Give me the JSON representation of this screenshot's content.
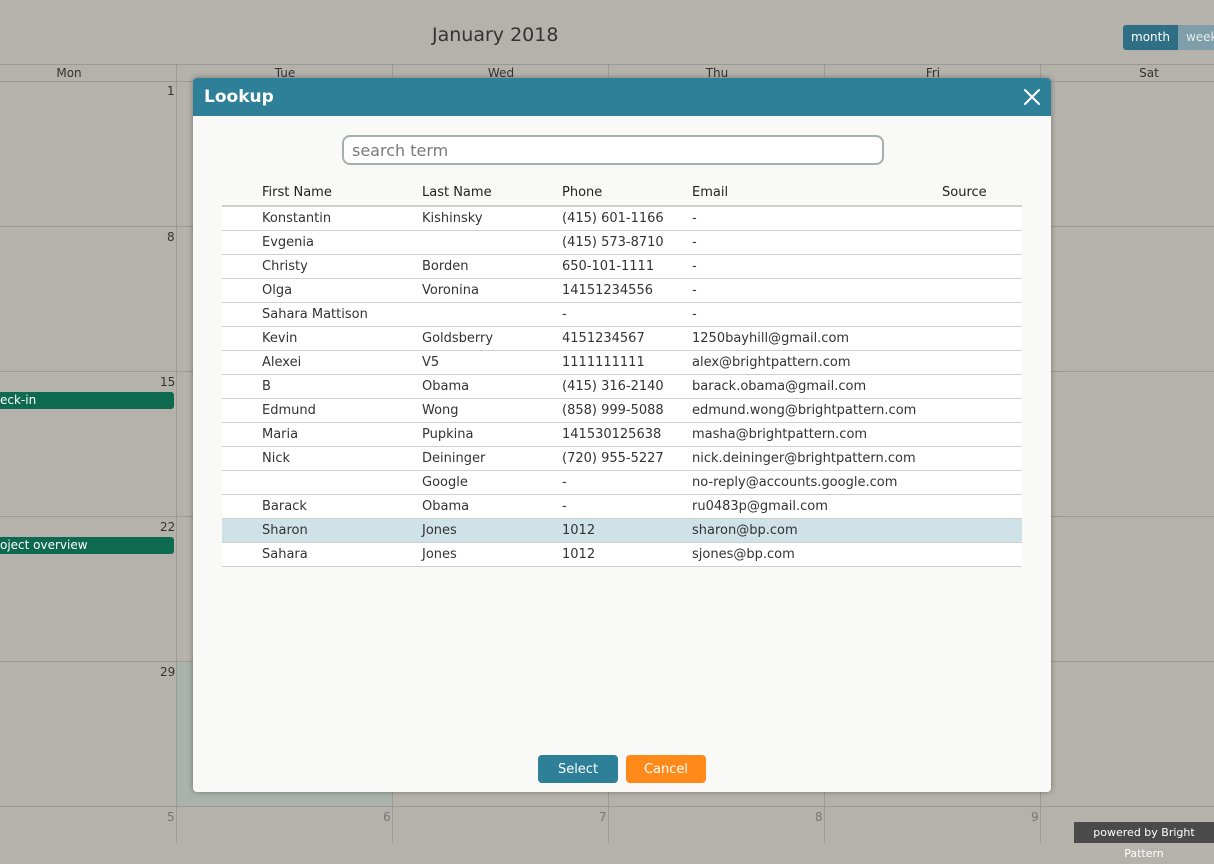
{
  "calendar": {
    "title": "January 2018",
    "views": {
      "month": "month",
      "week": "week"
    },
    "days_of_week": [
      "Mon",
      "Tue",
      "Wed",
      "Thu",
      "Fri",
      "Sat"
    ],
    "day_numbers": [
      "1",
      "8",
      "15",
      "22",
      "29",
      "5",
      "6",
      "7",
      "8",
      "9"
    ],
    "events": [
      "eck-in",
      "oject overview"
    ],
    "colors": {
      "event": "#0d6a4f",
      "view_active": "#2e6f85"
    }
  },
  "lookup": {
    "title": "Lookup",
    "search_placeholder": "search term",
    "columns": [
      "First Name",
      "Last Name",
      "Phone",
      "Email",
      "Source"
    ],
    "rows": [
      {
        "first": "Konstantin",
        "last": "Kishinsky",
        "phone": "(415) 601-1166",
        "email": "-",
        "source": ""
      },
      {
        "first": "Evgenia",
        "last": "",
        "phone": "(415) 573-8710",
        "email": "-",
        "source": ""
      },
      {
        "first": "Christy",
        "last": "Borden",
        "phone": "650-101-1111",
        "email": "-",
        "source": ""
      },
      {
        "first": "Olga",
        "last": "Voronina",
        "phone": "14151234556",
        "email": "-",
        "source": ""
      },
      {
        "first": "Sahara Mattison",
        "last": "",
        "phone": "-",
        "email": "-",
        "source": ""
      },
      {
        "first": "Kevin",
        "last": "Goldsberry",
        "phone": "4151234567",
        "email": "1250bayhill@gmail.com",
        "source": ""
      },
      {
        "first": "Alexei",
        "last": "V5",
        "phone": "1111111111",
        "email": "alex@brightpattern.com",
        "source": ""
      },
      {
        "first": "B",
        "last": "Obama",
        "phone": "(415) 316-2140",
        "email": "barack.obama@gmail.com",
        "source": ""
      },
      {
        "first": "Edmund",
        "last": "Wong",
        "phone": "(858) 999-5088",
        "email": "edmund.wong@brightpattern.com",
        "source": ""
      },
      {
        "first": "Maria",
        "last": "Pupkina",
        "phone": "141530125638",
        "email": "masha@brightpattern.com",
        "source": ""
      },
      {
        "first": "Nick",
        "last": "Deininger",
        "phone": "(720) 955-5227",
        "email": "nick.deininger@brightpattern.com",
        "source": ""
      },
      {
        "first": "",
        "last": "Google",
        "phone": "-",
        "email": "no-reply@accounts.google.com",
        "source": ""
      },
      {
        "first": "Barack",
        "last": "Obama",
        "phone": "-",
        "email": "ru0483p@gmail.com",
        "source": ""
      },
      {
        "first": "Sharon",
        "last": "Jones",
        "phone": "1012",
        "email": "sharon@bp.com",
        "source": "",
        "selected": true
      },
      {
        "first": "Sahara",
        "last": "Jones",
        "phone": "1012",
        "email": "sjones@bp.com",
        "source": ""
      }
    ],
    "buttons": {
      "select": "Select",
      "cancel": "Cancel"
    },
    "colors": {
      "header": "#2e7f98",
      "select": "#2e7f98",
      "cancel": "#ff8a1a",
      "selected_row": "#cfe2e8"
    }
  },
  "footer": {
    "powered_by": "powered by Bright Pattern"
  }
}
